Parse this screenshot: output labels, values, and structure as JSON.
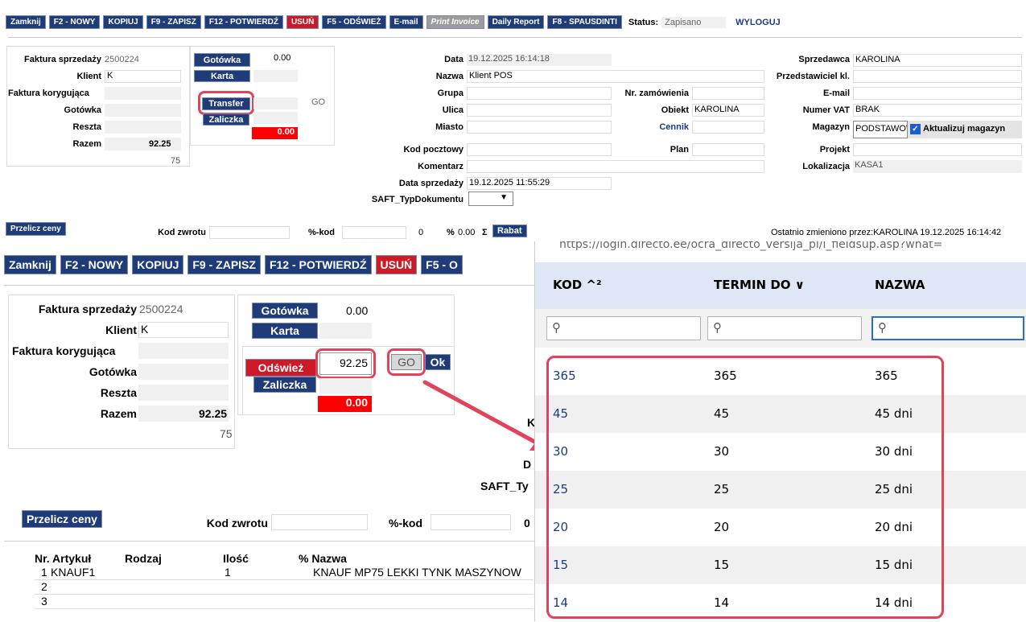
{
  "toolbar": {
    "buttons": [
      "Zamknij",
      "F2 - NOWY",
      "KOPIUJ",
      "F9 - ZAPISZ",
      "F12 - POTWIERDŹ",
      "USUŃ",
      "F5 - ODŚWIEŻ",
      "E-mail",
      "Print Invoice",
      "Daily Report",
      "F8 - SPAUSDINTI"
    ],
    "status_label": "Status:",
    "status_value": "Zapisano",
    "logout": "WYLOGUJ"
  },
  "header": {
    "faktura_label": "Faktura sprzedaży",
    "faktura_value": "2500224",
    "klient_label": "Klient",
    "klient_value": "K",
    "korygujaca_label": "Faktura korygująca",
    "gotowka_label": "Gotówka",
    "reszta_label": "Reszta",
    "razem_label": "Razem",
    "razem_value": "92.25",
    "count": "75",
    "btn_gotowka": "Gotówka",
    "gotowka_amount": "0.00",
    "btn_karta": "Karta",
    "btn_transfer": "Transfer",
    "go": "GO",
    "btn_zaliczka": "Zaliczka",
    "red_amount": "0.00",
    "data_label": "Data",
    "data_value": "19.12.2025 16:14:18",
    "nazwa_label": "Nazwa",
    "nazwa_value": "Klient POS",
    "grupa_label": "Grupa",
    "ulica_label": "Ulica",
    "miasto_label": "Miasto",
    "kod_label": "Kod pocztowy",
    "komentarz_label": "Komentarz",
    "data_sprz_label": "Data sprzedaży",
    "data_sprz_value": "19.12.2025 11:55:29",
    "saft_label": "SAFT_TypDokumentu",
    "nr_zam_label": "Nr. zamówienia",
    "obiekt_label": "Obiekt",
    "obiekt_value": "KAROLINA",
    "cennik_label": "Cennik",
    "plan_label": "Plan",
    "sprzedawca_label": "Sprzedawca",
    "sprzedawca_value": "KAROLINA",
    "przedst_label": "Przedstawiciel kl.",
    "email_label": "E-mail",
    "vat_label": "Numer VAT",
    "vat_value": "BRAK",
    "magazyn_label": "Magazyn",
    "magazyn_value": "PODSTAWOWY",
    "aktualizuj": "Aktualizuj magazyn",
    "projekt_label": "Projekt",
    "lokal_label": "Lokalizacja",
    "lokal_value": "KASA1"
  },
  "midbar": {
    "przelicz": "Przelicz ceny",
    "kod_zwrotu": "Kod zwrotu",
    "pkod": "%-kod",
    "zero": "0",
    "pct": "%",
    "pct_val": "0.00",
    "sigma": "Σ",
    "rabat": "Rabat",
    "changed": "Ostatnio zmieniono przez:KAROLINA 19.12.2025 16:14:42"
  },
  "zoom": {
    "buttons": [
      "Zamknij",
      "F2 - NOWY",
      "KOPIUJ",
      "F9 - ZAPISZ",
      "F12 - POTWIERDŹ",
      "USUŃ",
      "F5 - O"
    ],
    "faktura_label": "Faktura sprzedaży",
    "faktura_value": "2500224",
    "klient_label": "Klient",
    "klient_value": "K",
    "korygujaca_label": "Faktura korygująca",
    "gotowka_label": "Gotówka",
    "reszta_label": "Reszta",
    "razem_label": "Razem",
    "razem_value": "92.25",
    "count": "75",
    "btn_gotowka": "Gotówka",
    "gotowka_amount": "0.00",
    "btn_karta": "Karta",
    "btn_odswiez": "Odśwież",
    "amount": "92.25",
    "go": "GO",
    "ok": "Ok",
    "btn_zaliczka": "Zaliczka",
    "red_amount": "0.00",
    "k": "K",
    "d": "D",
    "saft": "SAFT_Ty",
    "przelicz": "Przelicz ceny",
    "kod_zwrotu": "Kod zwrotu",
    "pkod": "%-kod",
    "zero": "0",
    "col_nr": "Nr. Artykuł",
    "col_rodzaj": "Rodzaj",
    "col_ilosc": "Ilość",
    "col_pct": "% Nazwa",
    "rows": [
      {
        "nr": "1",
        "art": "KNAUF1",
        "ilosc": "1",
        "nazwa": "KNAUF MP75 LEKKI TYNK MASZYNOW"
      },
      {
        "nr": "2",
        "art": "",
        "ilosc": "",
        "nazwa": ""
      },
      {
        "nr": "3",
        "art": "",
        "ilosc": "",
        "nazwa": ""
      }
    ]
  },
  "popup": {
    "url": "https://login.directo.ee/ocra_directo_versija_pl/l_fieldsup.asp?what=",
    "col_kod": "KOD ^²",
    "col_termin": "TERMIN DO ∨",
    "col_nazwa": "NAZWA",
    "rows": [
      {
        "kod": "365",
        "termin": "365",
        "nazwa": "365"
      },
      {
        "kod": "45",
        "termin": "45",
        "nazwa": "45 dni"
      },
      {
        "kod": "30",
        "termin": "30",
        "nazwa": "30 dni"
      },
      {
        "kod": "25",
        "termin": "25",
        "nazwa": "25 dni"
      },
      {
        "kod": "20",
        "termin": "20",
        "nazwa": "20 dni"
      },
      {
        "kod": "15",
        "termin": "15",
        "nazwa": "15 dni"
      },
      {
        "kod": "14",
        "termin": "14",
        "nazwa": "14 dni"
      }
    ]
  },
  "colors": {
    "navy": "#1f3c78",
    "red": "#cc1b26",
    "highlight": "#e0445a",
    "link": "#1a3c8a"
  }
}
